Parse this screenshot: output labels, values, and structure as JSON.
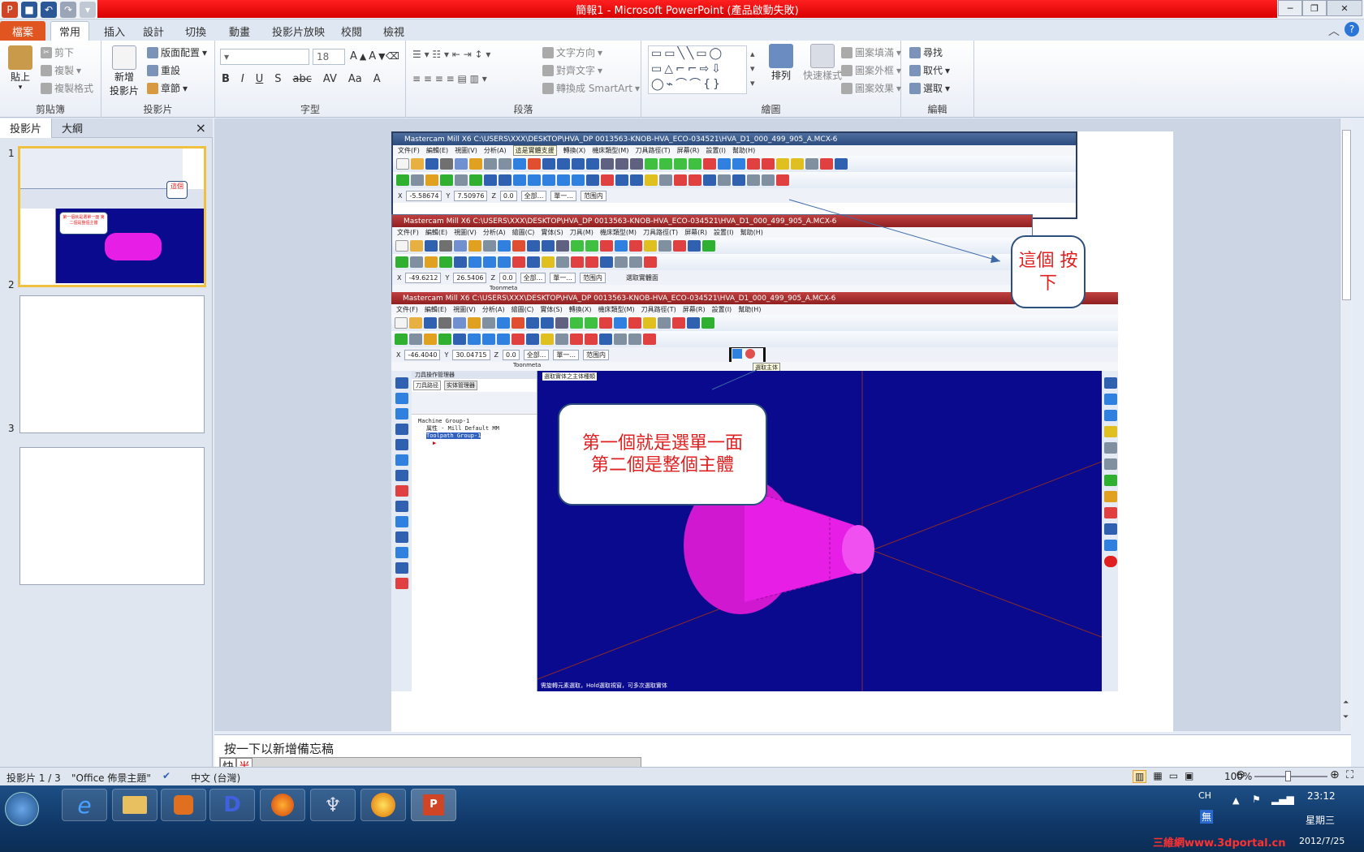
{
  "window": {
    "title": "簡報1 - Microsoft PowerPoint (產品啟動失敗)",
    "controls": {
      "minimize": "─",
      "restore": "❐",
      "close": "✕"
    }
  },
  "tabs": {
    "file": "檔案",
    "items": [
      "常用",
      "插入",
      "設計",
      "切換",
      "動畫",
      "投影片放映",
      "校閱",
      "檢視"
    ]
  },
  "ribbon": {
    "clipboard": {
      "label": "剪貼簿",
      "paste": "貼上",
      "cut": "剪下",
      "copy": "複製",
      "format_painter": "複製格式"
    },
    "slides": {
      "label": "投影片",
      "new_slide_line1": "新增",
      "new_slide_line2": "投影片",
      "layout": "版面配置",
      "reset": "重設",
      "section": "章節"
    },
    "font": {
      "label": "字型",
      "size": "18",
      "buttons": [
        "B",
        "I",
        "U",
        "S",
        "abc",
        "AV",
        "Aa",
        "A"
      ]
    },
    "paragraph": {
      "label": "段落",
      "text_direction": "文字方向",
      "align_text": "對齊文字",
      "smartart": "轉換成 SmartArt"
    },
    "drawing": {
      "label": "繪圖",
      "arrange": "排列",
      "quick_styles": "快速樣式",
      "fill": "圖案填滿",
      "outline": "圖案外框",
      "effects": "圖案效果"
    },
    "editing": {
      "label": "編輯",
      "find": "尋找",
      "replace": "取代",
      "select": "選取"
    }
  },
  "left_pane": {
    "tab_slides": "投影片",
    "tab_outline": "大綱",
    "close": "×",
    "slides": [
      {
        "num": "1"
      },
      {
        "num": "2"
      },
      {
        "num": "3"
      }
    ],
    "thumb1_callout": "第一個就是選單一面 第二個是整個主體"
  },
  "slide": {
    "mc1": {
      "title": "Mastercam Mill X6  C:\\USERS\\XXX\\DESKTOP\\HVA_DP 0013563-KNOB-HVA_ECO-034521\\HVA_D1_000_499_905_A.MCX-6",
      "menu": [
        "文件(F)",
        "編輯(E)",
        "視圖(V)",
        "分析(A)",
        "轉換(X)",
        "機床類型(M)",
        "刀具路徑(T)",
        "屏幕(R)",
        "設置(I)",
        "幫助(H)"
      ],
      "tooltip": "這是實體支援",
      "inputs": [
        "-5.58674",
        "7.50976",
        "0.0",
        "全部...",
        "單一...",
        "范围内"
      ]
    },
    "mc2": {
      "title": "Mastercam Mill X6  C:\\USERS\\XXX\\DESKTOP\\HVA_DP 0013563-KNOB-HVA_ECO-034521\\HVA_D1_000_499_905_A.MCX-6",
      "menu": [
        "文件(F)",
        "編輯(E)",
        "視圖(V)",
        "分析(A)",
        "繪圖(C)",
        "實体(S)",
        "刀具(M)",
        "機床類型(M)",
        "刀具路徑(T)",
        "屏幕(R)",
        "設置(I)",
        "幫助(H)"
      ],
      "inputs": [
        "-49.6212",
        "26.5406",
        "0.0",
        "全部...",
        "單一...",
        "范围内"
      ],
      "status": "Toonmeta",
      "tooltip": "選取實體面"
    },
    "mc3": {
      "title": "Mastercam Mill X6  C:\\USERS\\XXX\\DESKTOP\\HVA_DP 0013563-KNOB-HVA_ECO-034521\\HVA_D1_000_499_905_A.MCX-6",
      "menu": [
        "文件(F)",
        "編輯(E)",
        "視圖(V)",
        "分析(A)",
        "繪圖(C)",
        "實体(S)",
        "轉換(X)",
        "機床類型(M)",
        "刀具路徑(T)",
        "屏幕(R)",
        "設置(I)",
        "幫助(H)"
      ],
      "inputs": [
        "-46.4040",
        "30.04715",
        "0.0",
        "全部...",
        "單一...",
        "范围内"
      ],
      "status": "Toonmeta",
      "tooltip": "選取主体",
      "op_manager": {
        "title": "刀具操作管理器",
        "tabs": [
          "刀具路径",
          "实体管理器"
        ],
        "tree": [
          "Machine Group-1",
          "属性 - Mill Default MM",
          "Toolpath Group-1"
        ]
      },
      "viewport_label": "選取實体之主体種類",
      "status_text": "需旋轉元素選取，Hold選取視窗，可多次選取實体"
    },
    "callout_small": "這個 按下",
    "callout_main_line1": "第一個就是選單一面",
    "callout_main_line2": "第二個是整個主體"
  },
  "notes": {
    "placeholder": "按一下以新增備忘稿"
  },
  "ime": {
    "key1": "快",
    "key2": "半"
  },
  "status": {
    "slide": "投影片 1 / 3",
    "theme": "\"Office 佈景主題\"",
    "lang": "中文 (台灣)",
    "zoom": "100%"
  },
  "taskbar": {
    "lang": "CH",
    "ime": "無",
    "time": "23:12",
    "day": "星期三",
    "date": "2012/7/25",
    "watermark": "三維網www.3dportal.cn"
  },
  "colors": {
    "title_band": "#e00000",
    "file_tab": "#e15520",
    "viewport": "#0a0a8e",
    "part": "#e61ee6",
    "callout_text": "#e02020"
  }
}
